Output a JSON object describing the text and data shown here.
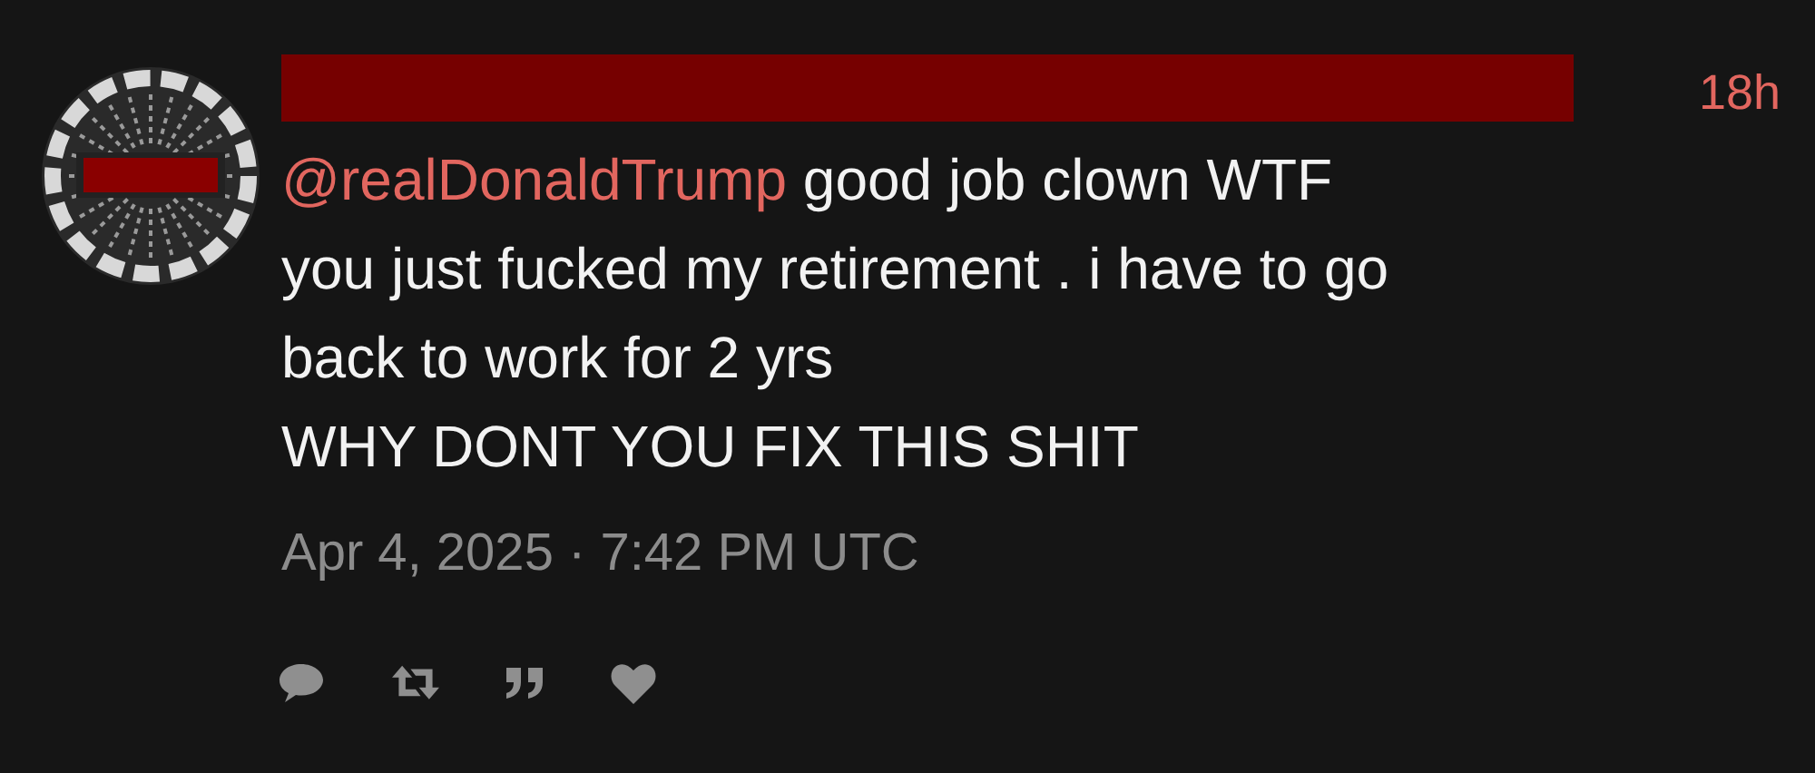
{
  "tweet": {
    "time": "18h",
    "mention": "@realDonaldTrump",
    "text": " good job clown WTF\nyou just fucked my retirement . i have to go\nback to work for 2 yrs\nWHY DONT YOU FIX THIS SHIT",
    "date": "Apr 4, 2025 · 7:42 PM UTC",
    "actions": [
      {
        "kind": "reply"
      },
      {
        "kind": "retweet"
      },
      {
        "kind": "quote"
      },
      {
        "kind": "like"
      }
    ]
  }
}
